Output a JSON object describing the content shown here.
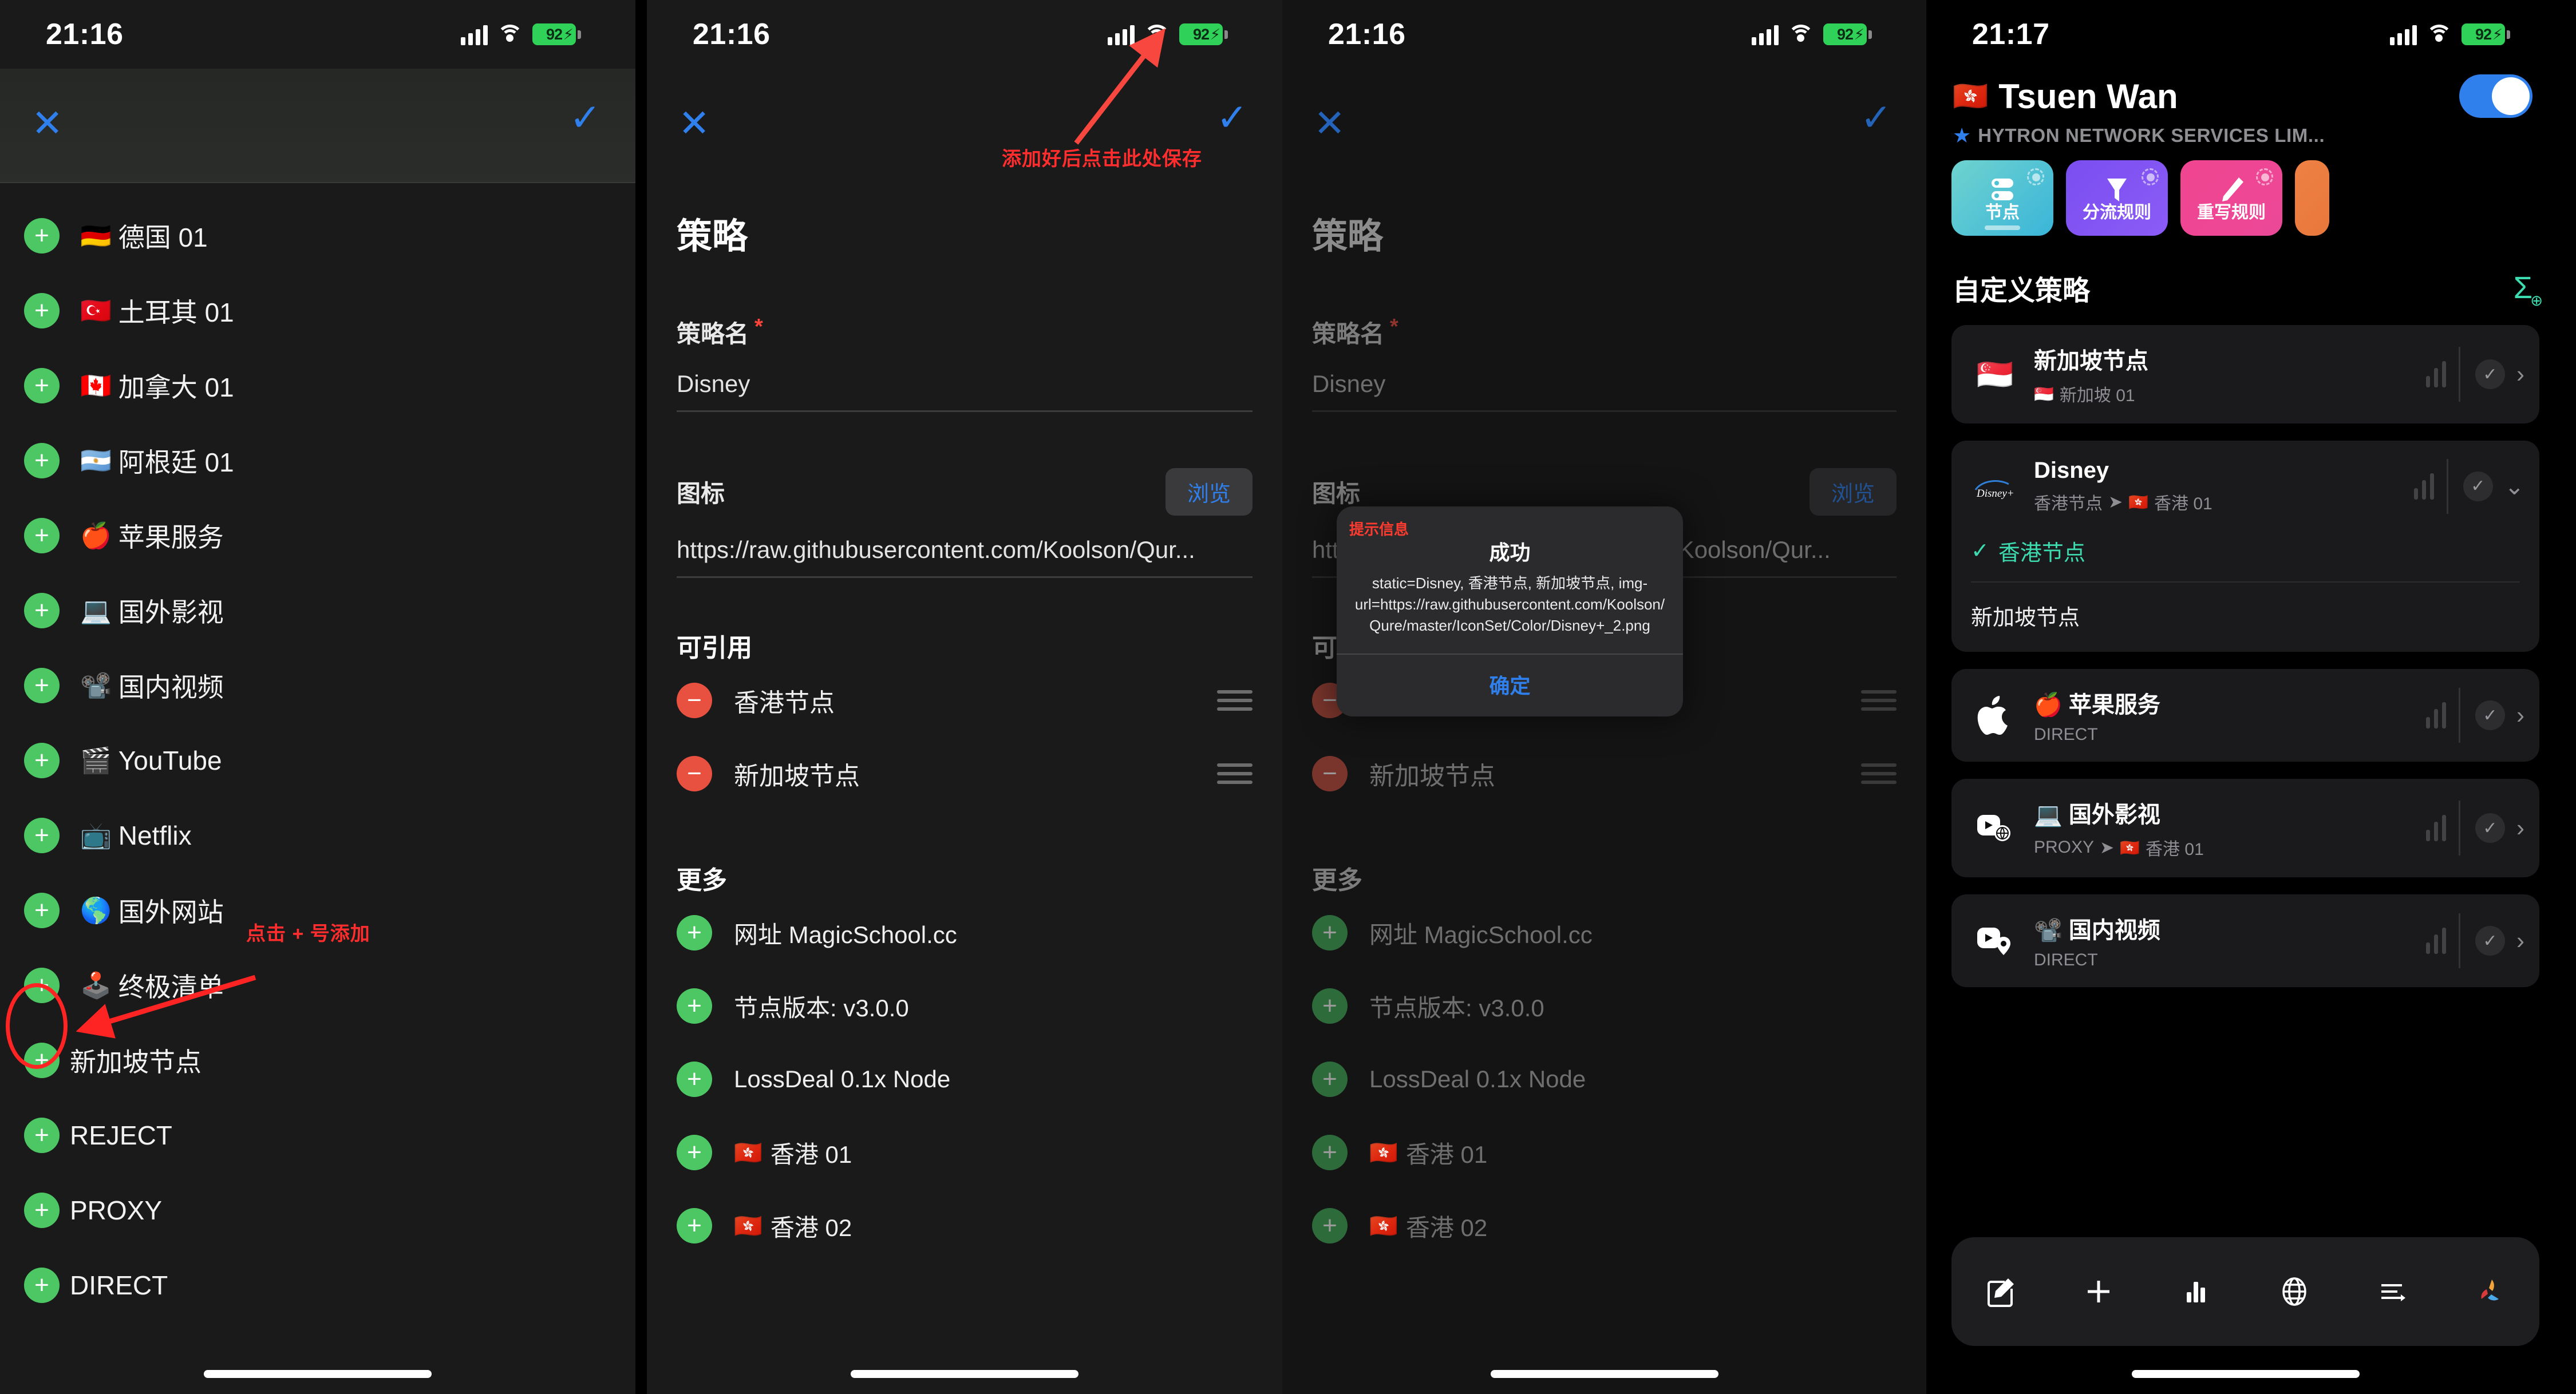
{
  "status_bar": {
    "time_1216": "21:16",
    "time_1217": "21:17",
    "battery": "92"
  },
  "panel1": {
    "close_label": "✕",
    "done_label": "✓",
    "items": [
      {
        "emoji": "🇩🇪",
        "label": "德国 01"
      },
      {
        "emoji": "🇹🇷",
        "label": "土耳其 01"
      },
      {
        "emoji": "🇨🇦",
        "label": "加拿大 01"
      },
      {
        "emoji": "🇦🇷",
        "label": "阿根廷 01"
      },
      {
        "emoji": "🍎",
        "label": "苹果服务"
      },
      {
        "emoji": "💻",
        "label": "国外影视"
      },
      {
        "emoji": "📽️",
        "label": "国内视频"
      },
      {
        "emoji": "🎬",
        "label": "YouTube"
      },
      {
        "emoji": "📺",
        "label": "Netflix"
      },
      {
        "emoji": "🌎",
        "label": "国外网站"
      },
      {
        "emoji": "🕹️",
        "label": "终极清单"
      },
      {
        "emoji": "",
        "label": "新加坡节点"
      },
      {
        "emoji": "",
        "label": "REJECT"
      },
      {
        "emoji": "",
        "label": "PROXY"
      },
      {
        "emoji": "",
        "label": "DIRECT"
      }
    ],
    "annotation": "点击 + 号添加"
  },
  "panel2": {
    "close_label": "✕",
    "done_label": "✓",
    "title": "策略",
    "annotation": "添加好后点击此处保存",
    "name_label": "策略名",
    "name_required": "*",
    "name_value": "Disney",
    "icon_label": "图标",
    "browse_label": "浏览",
    "icon_value": "https://raw.githubusercontent.com/Koolson/Qur...",
    "ref_section": "可引用",
    "ref_items": [
      {
        "label": "香港节点"
      },
      {
        "label": "新加坡节点"
      }
    ],
    "more_section": "更多",
    "more_items": [
      {
        "emoji": "",
        "label": "网址 MagicSchool.cc"
      },
      {
        "emoji": "",
        "label": "节点版本: v3.0.0"
      },
      {
        "emoji": "",
        "label": "LossDeal 0.1x Node"
      },
      {
        "emoji": "🇭🇰",
        "label": "香港 01"
      },
      {
        "emoji": "🇭🇰",
        "label": "香港 02"
      }
    ]
  },
  "panel3": {
    "close_label": "✕",
    "done_label": "✓",
    "title": "策略",
    "name_label": "策略名",
    "name_required": "*",
    "name_value": "Disney",
    "icon_label": "图标",
    "browse_label": "浏览",
    "icon_value": "https://raw.githubusercontent.com/Koolson/Qur...",
    "ref_section": "可引用",
    "ref_items": [
      {
        "label": "香港节点"
      },
      {
        "label": "新加坡节点"
      }
    ],
    "more_section": "更多",
    "more_items": [
      {
        "emoji": "",
        "label": "网址 MagicSchool.cc"
      },
      {
        "emoji": "",
        "label": "节点版本: v3.0.0"
      },
      {
        "emoji": "",
        "label": "LossDeal 0.1x Node"
      },
      {
        "emoji": "🇭🇰",
        "label": "香港 01"
      },
      {
        "emoji": "🇭🇰",
        "label": "香港 02"
      }
    ],
    "alert": {
      "tip": "提示信息",
      "title": "成功",
      "message": "static=Disney, 香港节点, 新加坡节点, img-url=https://raw.githubusercontent.com/Koolson/Qure/master/IconSet/Color/Disney+_2.png",
      "ok_label": "确定"
    }
  },
  "panel4": {
    "flag": "🇭🇰",
    "title": "Tsuen Wan",
    "subtitle": "HYTRON NETWORK SERVICES LIM...",
    "toggle_on": true,
    "tiles": [
      {
        "label": "节点",
        "icon": "server-icon"
      },
      {
        "label": "分流规则",
        "icon": "filter-icon"
      },
      {
        "label": "重写规则",
        "icon": "pencil-icon"
      }
    ],
    "section_title": "自定义策略",
    "add_label": "Σ",
    "cards": [
      {
        "icon": "🇸🇬",
        "title": "新加坡节点",
        "sub_flag": "🇸🇬",
        "sub": "新加坡 01",
        "sub_prefix": "",
        "chevron": "›",
        "expanded": false
      },
      {
        "icon": "disney-plus-logo",
        "title": "Disney",
        "sub_prefix": "香港节点",
        "sub_flag": "🇭🇰",
        "sub": "香港 01",
        "chevron": "⌄",
        "expanded": true,
        "selected_option": "香港节点",
        "other_option": "新加坡节点"
      },
      {
        "icon": "apple-logo",
        "title": "🍎 苹果服务",
        "sub_prefix": "DIRECT",
        "sub_flag": "",
        "sub": "",
        "chevron": "›",
        "expanded": false
      },
      {
        "icon": "media-globe-icon",
        "title": "💻 国外影视",
        "sub_prefix": "PROXY",
        "sub_flag": "🇭🇰",
        "sub": "香港 01",
        "chevron": "›",
        "expanded": false
      },
      {
        "icon": "media-pin-icon",
        "title": "📽️ 国内视频",
        "sub_prefix": "DIRECT",
        "sub_flag": "",
        "sub": "",
        "chevron": "›",
        "expanded": false
      }
    ],
    "tabs": [
      {
        "name": "compose-icon"
      },
      {
        "name": "plus-icon"
      },
      {
        "name": "chart-icon"
      },
      {
        "name": "globe-icon"
      },
      {
        "name": "requests-icon"
      },
      {
        "name": "app-logo-icon"
      }
    ]
  },
  "colors": {
    "accent_blue": "#2f80ed",
    "green_add": "#4cc764",
    "red_remove": "#e8513f",
    "annotation_red": "#ff2d2d",
    "teal": "#3ddbb0",
    "battery_green": "#30d158"
  }
}
